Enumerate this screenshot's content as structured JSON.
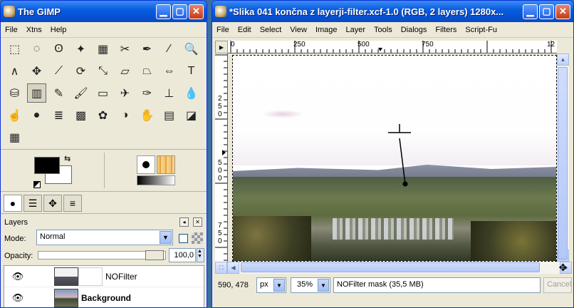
{
  "toolbox": {
    "title": "The GIMP",
    "menu": [
      "File",
      "Xtns",
      "Help"
    ],
    "tools": [
      {
        "name": "rect-select-icon",
        "glyph": "⬚"
      },
      {
        "name": "ellipse-select-icon",
        "glyph": "◌"
      },
      {
        "name": "free-select-icon",
        "glyph": "ʘ"
      },
      {
        "name": "fuzzy-select-icon",
        "glyph": "✦"
      },
      {
        "name": "select-by-color-icon",
        "glyph": "▦"
      },
      {
        "name": "scissors-icon",
        "glyph": "✂"
      },
      {
        "name": "paths-icon",
        "glyph": "✒"
      },
      {
        "name": "color-picker-icon",
        "glyph": "⁄"
      },
      {
        "name": "zoom-icon",
        "glyph": "🔍"
      },
      {
        "name": "measure-icon",
        "glyph": "∧"
      },
      {
        "name": "move-icon",
        "glyph": "✥"
      },
      {
        "name": "crop-icon",
        "glyph": "⟋"
      },
      {
        "name": "rotate-icon",
        "glyph": "⟳"
      },
      {
        "name": "scale-icon",
        "glyph": "⤡"
      },
      {
        "name": "shear-icon",
        "glyph": "▱"
      },
      {
        "name": "perspective-icon",
        "glyph": "⏢"
      },
      {
        "name": "flip-icon",
        "glyph": "⇔"
      },
      {
        "name": "text-icon",
        "glyph": "T"
      },
      {
        "name": "bucket-fill-icon",
        "glyph": "⛁"
      },
      {
        "name": "blend-icon",
        "glyph": "▥"
      },
      {
        "name": "pencil-icon",
        "glyph": "✎"
      },
      {
        "name": "paintbrush-icon",
        "glyph": "🖌"
      },
      {
        "name": "eraser-icon",
        "glyph": "▭"
      },
      {
        "name": "airbrush-icon",
        "glyph": "✈"
      },
      {
        "name": "ink-icon",
        "glyph": "✑"
      },
      {
        "name": "clone-icon",
        "glyph": "⊥"
      },
      {
        "name": "convolve-icon",
        "glyph": "💧"
      },
      {
        "name": "smudge-icon",
        "glyph": "☝"
      },
      {
        "name": "dodge-burn-icon",
        "glyph": "●"
      },
      {
        "name": "curves-icon",
        "glyph": "≣"
      },
      {
        "name": "levels-icon",
        "glyph": "▩"
      },
      {
        "name": "color-balance-icon",
        "glyph": "✿"
      },
      {
        "name": "threshold-icon",
        "glyph": "◑"
      },
      {
        "name": "hue-saturation-icon",
        "glyph": "✋"
      },
      {
        "name": "brightness-contrast-icon",
        "glyph": "▤"
      },
      {
        "name": "transform-icon",
        "glyph": "◪"
      },
      {
        "name": "gradient-editor-icon",
        "glyph": "▦"
      }
    ],
    "active_tool_index": 19,
    "colors": {
      "foreground": "#000000",
      "background": "#ffffff"
    },
    "dock_tabs": [
      "brush-tab-icon",
      "layers-tab-icon",
      "move-tab-icon",
      "channels-tab-icon"
    ]
  },
  "layers": {
    "title": "Layers",
    "mode_label": "Mode:",
    "mode_value": "Normal",
    "opacity_label": "Opacity:",
    "opacity_value": "100,0",
    "opacity_fraction": 1.0,
    "rows": [
      {
        "name": "NOFilter",
        "visible": true,
        "bold": false
      },
      {
        "name": "Background",
        "visible": true,
        "bold": true
      }
    ]
  },
  "image_window": {
    "title": "*Slika 041 končna z layerji-filter.xcf-1.0 (RGB, 2 layers) 1280x...",
    "menu": [
      "File",
      "Edit",
      "Select",
      "View",
      "Image",
      "Layer",
      "Tools",
      "Dialogs",
      "Filters",
      "Script-Fu"
    ],
    "hruler_labels": [
      "0",
      "250",
      "500",
      "750",
      "12"
    ],
    "vruler_labels": [
      "2\n5\n0",
      "5\n0\n0",
      "7\n5\n0"
    ],
    "status": {
      "coords": "590, 478",
      "unit": "px",
      "zoom": "35%",
      "info": "NOFilter mask (35,5 MB)",
      "cancel": "Cancel"
    }
  }
}
